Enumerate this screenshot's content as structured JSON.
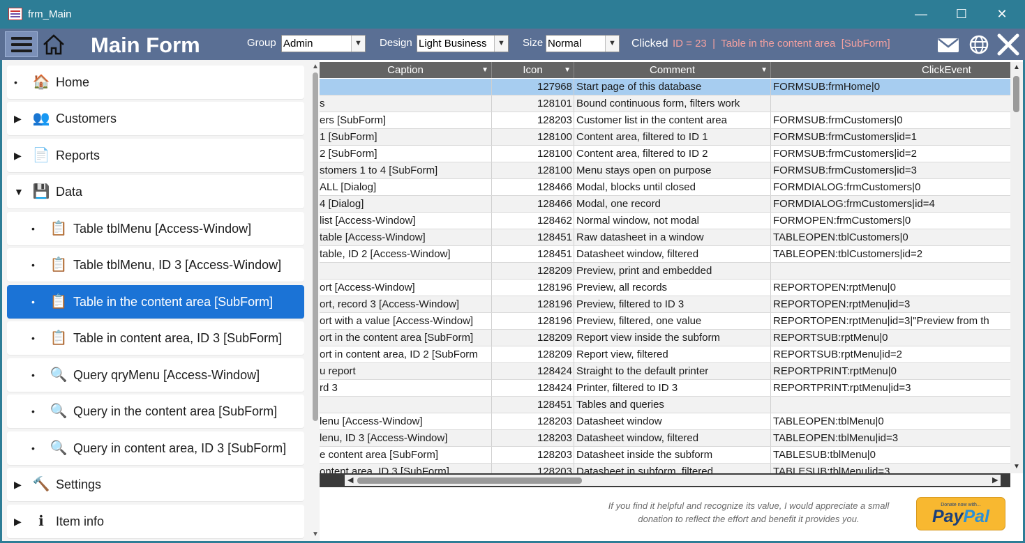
{
  "window": {
    "title": "frm_Main",
    "minimize": "—",
    "maximize": "☐",
    "close": "✕"
  },
  "header": {
    "title": "Main Form",
    "group_label": "Group",
    "group_value": "Admin",
    "design_label": "Design",
    "design_value": "Light Business",
    "size_label": "Size",
    "size_value": "Normal",
    "clicked_label": "Clicked",
    "clicked_value": "ID = 23  |  Table in the content area  [SubForm]"
  },
  "sidebar": {
    "items": [
      {
        "label": "Home",
        "marker": "•",
        "icon": "house-icon"
      },
      {
        "label": "Customers",
        "marker": "▶",
        "icon": "people-icon"
      },
      {
        "label": "Reports",
        "marker": "▶",
        "icon": "report-icon"
      },
      {
        "label": "Data",
        "marker": "▼",
        "icon": "database-icon"
      },
      {
        "label": "Table tblMenu [Access-Window]",
        "marker": "•",
        "icon": "clipboard-icon"
      },
      {
        "label": "Table tblMenu, ID 3 [Access-Window]",
        "marker": "•",
        "icon": "clipboard-icon"
      },
      {
        "label": "Table in the content area [SubForm]",
        "marker": "•",
        "icon": "clipboard-icon",
        "selected": true
      },
      {
        "label": "Table in content area, ID 3 [SubForm]",
        "marker": "•",
        "icon": "clipboard-icon"
      },
      {
        "label": "Query qryMenu [Access-Window]",
        "marker": "•",
        "icon": "magnifier-icon"
      },
      {
        "label": "Query in the content area [SubForm]",
        "marker": "•",
        "icon": "magnifier-icon"
      },
      {
        "label": "Query in content area, ID 3 [SubForm]",
        "marker": "•",
        "icon": "magnifier-icon"
      },
      {
        "label": "Settings",
        "marker": "▶",
        "icon": "hammer-icon"
      },
      {
        "label": "Item info",
        "marker": "▶",
        "icon": "info-icon"
      }
    ]
  },
  "grid": {
    "columns": [
      "Caption",
      "Icon",
      "Comment",
      "ClickEvent"
    ],
    "rows": [
      {
        "caption": "",
        "icon": "127968",
        "comment": "Start page of this database",
        "click": "FORMSUB:frmHome|0"
      },
      {
        "caption": "s",
        "icon": "128101",
        "comment": "Bound continuous form, filters work",
        "click": ""
      },
      {
        "caption": "ers  [SubForm]",
        "icon": "128203",
        "comment": "Customer list in the content area",
        "click": "FORMSUB:frmCustomers|0"
      },
      {
        "caption": "1  [SubForm]",
        "icon": "128100",
        "comment": "Content area, filtered to ID 1",
        "click": "FORMSUB:frmCustomers|id=1"
      },
      {
        "caption": "2  [SubForm]",
        "icon": "128100",
        "comment": "Content area, filtered to ID 2",
        "click": "FORMSUB:frmCustomers|id=2"
      },
      {
        "caption": "stomers 1 to 4  [SubForm]",
        "icon": "128100",
        "comment": "Menu stays open on purpose",
        "click": "FORMSUB:frmCustomers|id=3"
      },
      {
        "caption": "ALL  [Dialog]",
        "icon": "128466",
        "comment": "Modal, blocks until closed",
        "click": "FORMDIALOG:frmCustomers|0"
      },
      {
        "caption": "4  [Dialog]",
        "icon": "128466",
        "comment": "Modal, one record",
        "click": "FORMDIALOG:frmCustomers|id=4"
      },
      {
        "caption": "list  [Access-Window]",
        "icon": "128462",
        "comment": "Normal window, not modal",
        "click": "FORMOPEN:frmCustomers|0"
      },
      {
        "caption": "table  [Access-Window]",
        "icon": "128451",
        "comment": "Raw datasheet in a window",
        "click": "TABLEOPEN:tblCustomers|0"
      },
      {
        "caption": "table, ID 2  [Access-Window]",
        "icon": "128451",
        "comment": "Datasheet window, filtered",
        "click": "TABLEOPEN:tblCustomers|id=2"
      },
      {
        "caption": "",
        "icon": "128209",
        "comment": "Preview, print and embedded",
        "click": ""
      },
      {
        "caption": "ort  [Access-Window]",
        "icon": "128196",
        "comment": "Preview, all records",
        "click": "REPORTOPEN:rptMenu|0"
      },
      {
        "caption": "ort, record 3  [Access-Window]",
        "icon": "128196",
        "comment": "Preview, filtered to ID 3",
        "click": "REPORTOPEN:rptMenu|id=3"
      },
      {
        "caption": "ort with a value  [Access-Window]",
        "icon": "128196",
        "comment": "Preview, filtered, one value",
        "click": "REPORTOPEN:rptMenu|id=3|\"Preview from th"
      },
      {
        "caption": "ort in the content area  [SubForm]",
        "icon": "128209",
        "comment": "Report view inside the subform",
        "click": "REPORTSUB:rptMenu|0"
      },
      {
        "caption": "ort in content area, ID 2  [SubForm",
        "icon": "128209",
        "comment": "Report view, filtered",
        "click": "REPORTSUB:rptMenu|id=2"
      },
      {
        "caption": "u report",
        "icon": "128424",
        "comment": "Straight to the default printer",
        "click": "REPORTPRINT:rptMenu|0"
      },
      {
        "caption": "rd 3",
        "icon": "128424",
        "comment": "Printer, filtered to ID 3",
        "click": "REPORTPRINT:rptMenu|id=3"
      },
      {
        "caption": "",
        "icon": "128451",
        "comment": "Tables and queries",
        "click": ""
      },
      {
        "caption": "lenu  [Access-Window]",
        "icon": "128203",
        "comment": "Datasheet window",
        "click": "TABLEOPEN:tblMenu|0"
      },
      {
        "caption": "lenu, ID 3  [Access-Window]",
        "icon": "128203",
        "comment": "Datasheet window, filtered",
        "click": "TABLEOPEN:tblMenu|id=3"
      },
      {
        "caption": "e content area  [SubForm]",
        "icon": "128203",
        "comment": "Datasheet inside the subform",
        "click": "TABLESUB:tblMenu|0"
      },
      {
        "caption": "ontent area, ID 3  [SubForm]",
        "icon": "128203",
        "comment": "Datasheet in subform, filtered",
        "click": "TABLESUB:tblMenu|id=3"
      }
    ]
  },
  "footer": {
    "note": "If you find it helpful and recognize its value, I would appreciate a small donation to reflect the effort and benefit it provides you.",
    "paypal_small": "Donate now with...",
    "paypal_pay": "Pay",
    "paypal_pal": "Pal"
  }
}
